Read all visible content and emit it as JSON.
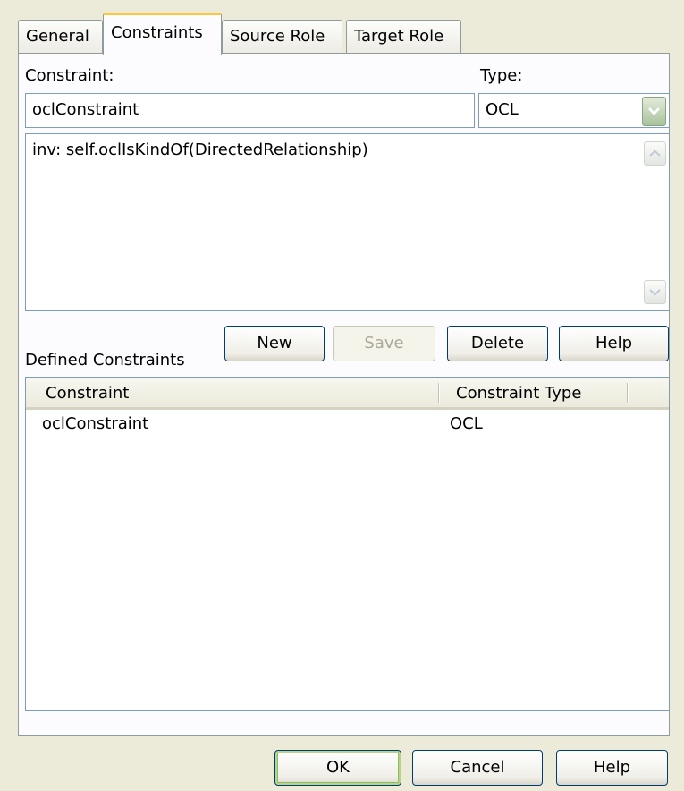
{
  "tabs": [
    {
      "label": "General",
      "active": false
    },
    {
      "label": "Constraints",
      "active": true
    },
    {
      "label": "Source Role",
      "active": false
    },
    {
      "label": "Target Role",
      "active": false
    }
  ],
  "constraint_label": "Constraint:",
  "constraint_value": "oclConstraint",
  "type_label": "Type:",
  "type_value": "OCL",
  "body_text": "inv: self.oclIsKindOf(DirectedRelationship)",
  "defined_label": "Defined Constraints",
  "buttons": {
    "new": "New",
    "save": "Save",
    "delete": "Delete",
    "help": "Help"
  },
  "list": {
    "columns": [
      "Constraint",
      "Constraint Type"
    ],
    "rows": [
      {
        "name": "oclConstraint",
        "type": "OCL"
      }
    ]
  },
  "footer": {
    "ok": "OK",
    "cancel": "Cancel",
    "help": "Help"
  },
  "icons": {
    "dropdown": "chevron-down-icon",
    "scroll_up": "scroll-up-arrow-icon",
    "scroll_down": "scroll-down-arrow-icon"
  },
  "colors": {
    "accent_tab": "#ffc83c",
    "default_button": "#8fbe5e",
    "dropdown": "#a8c29c"
  }
}
